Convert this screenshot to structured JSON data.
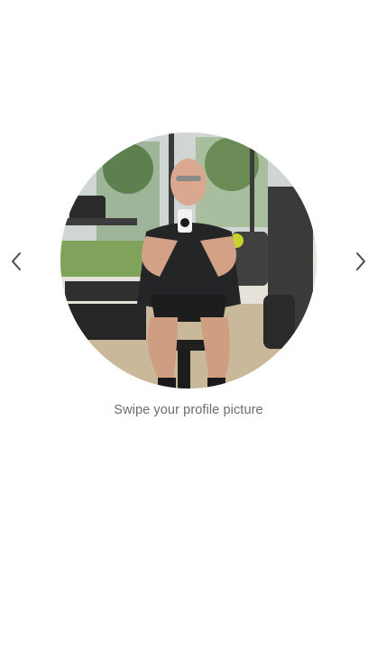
{
  "profile": {
    "caption": "Swipe your profile picture",
    "image_subject": "gym mirror selfie"
  },
  "navigation": {
    "prev_icon": "chevron-left-icon",
    "next_icon": "chevron-right-icon"
  },
  "colors": {
    "background": "#ffffff",
    "caption_text": "#6b6b6b",
    "chevron": "#4a4a4a"
  }
}
